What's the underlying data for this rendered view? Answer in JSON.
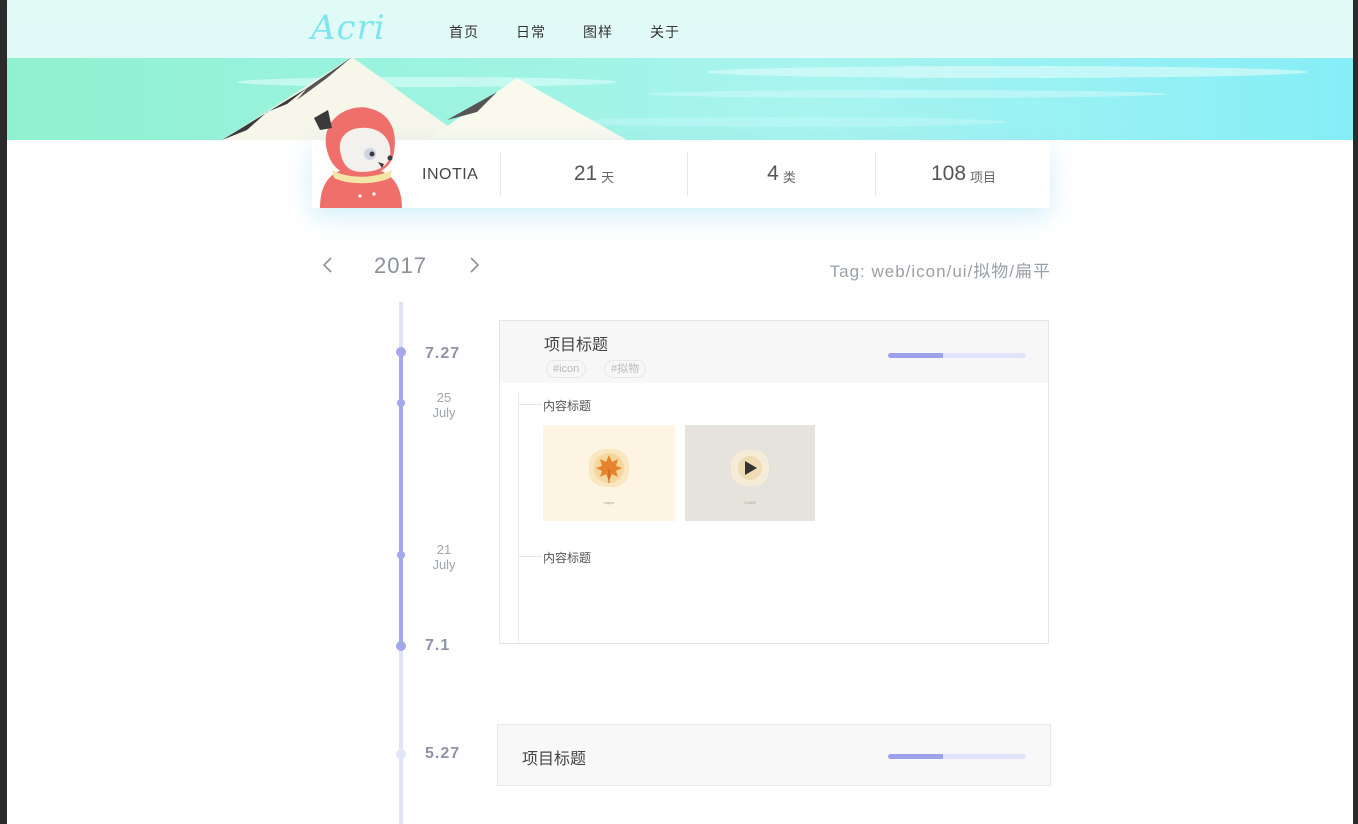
{
  "brand": {
    "logo": "Acri"
  },
  "nav": [
    {
      "label": "首页"
    },
    {
      "label": "日常"
    },
    {
      "label": "图样"
    },
    {
      "label": "关于"
    }
  ],
  "profile": {
    "username": "INOTIA",
    "stats": [
      {
        "value": "21",
        "unit": "天"
      },
      {
        "value": "4",
        "unit": "类"
      },
      {
        "value": "108",
        "unit": "项目"
      }
    ]
  },
  "timeline": {
    "year": "2017",
    "tag_filter": "Tag: web/icon/ui/拟物/扁平",
    "dates": [
      {
        "label": "7.27"
      },
      {
        "day": "25",
        "month": "July"
      },
      {
        "day": "21",
        "month": "July"
      },
      {
        "label": "7.1"
      },
      {
        "label": "5.27"
      }
    ]
  },
  "projects": [
    {
      "title": "项目标题",
      "tags": [
        "#icon",
        "#拟物"
      ],
      "progress": 0.4,
      "sections": [
        {
          "title": "内容标题",
          "thumbs": [
            {
              "icon": "maple-leaf-icon",
              "caption": "maple",
              "bg": "#fdf4e2"
            },
            {
              "icon": "play-icon",
              "caption": "CHAIR",
              "bg": "#e6e3dc"
            }
          ]
        },
        {
          "title": "内容标题"
        }
      ]
    },
    {
      "title": "项目标题",
      "progress": 0.4
    }
  ],
  "colors": {
    "accent": "#a3a8ea",
    "accent_light": "#e0e3fb",
    "sky": "#8af0f0"
  }
}
